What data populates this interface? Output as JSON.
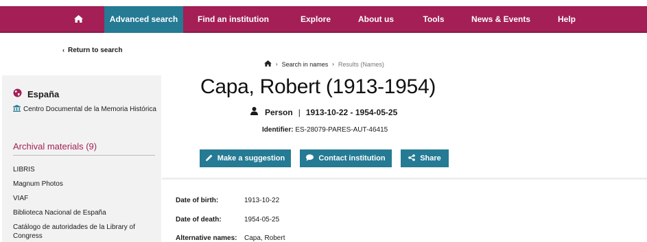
{
  "nav": {
    "home_icon": "home-icon",
    "items": [
      {
        "label": "Advanced search",
        "active": true
      },
      {
        "label": "Find an institution"
      },
      {
        "label": "Explore"
      },
      {
        "label": "About us"
      },
      {
        "label": "Tools"
      },
      {
        "label": "News & Events"
      },
      {
        "label": "Help"
      }
    ],
    "color": "#a31f56",
    "active_color": "#257a94"
  },
  "back_link": "Return to search",
  "breadcrumb": {
    "items": [
      "Search in names",
      "Results (Names)"
    ]
  },
  "sidebar": {
    "country": "España",
    "institution": "Centro Documental de la Memoria Histórica",
    "archival_heading": "Archival materials (9)",
    "archival_items": [
      "LIBRIS",
      "Magnum Photos",
      "VIAF",
      "Biblioteca Nacional de España",
      "Catálogo de autoridades de la Library of Congress"
    ]
  },
  "record": {
    "title": "Capa, Robert (1913-1954)",
    "type": "Person",
    "dates": "1913-10-22 - 1954-05-25",
    "identifier_label": "Identifier:",
    "identifier_value": "ES-28079-PARES-AUT-46415"
  },
  "actions": {
    "suggest": "Make a suggestion",
    "contact": "Contact institution",
    "share": "Share"
  },
  "details": [
    {
      "label": "Date of birth:",
      "value": "1913-10-22"
    },
    {
      "label": "Date of death:",
      "value": "1954-05-25"
    },
    {
      "label": "Alternative names:",
      "value": "Capa, Robert"
    }
  ]
}
